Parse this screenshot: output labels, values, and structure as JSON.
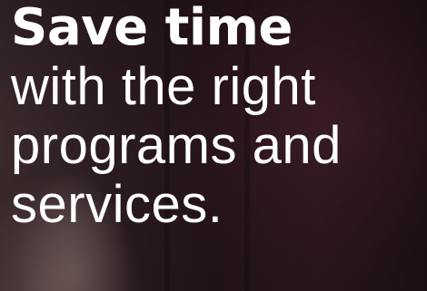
{
  "hero": {
    "headline_bold": "Save time",
    "headline_lines": [
      "with the right",
      "programs and",
      "services."
    ]
  },
  "colors": {
    "text": "#ffffff",
    "background": "#241419"
  }
}
